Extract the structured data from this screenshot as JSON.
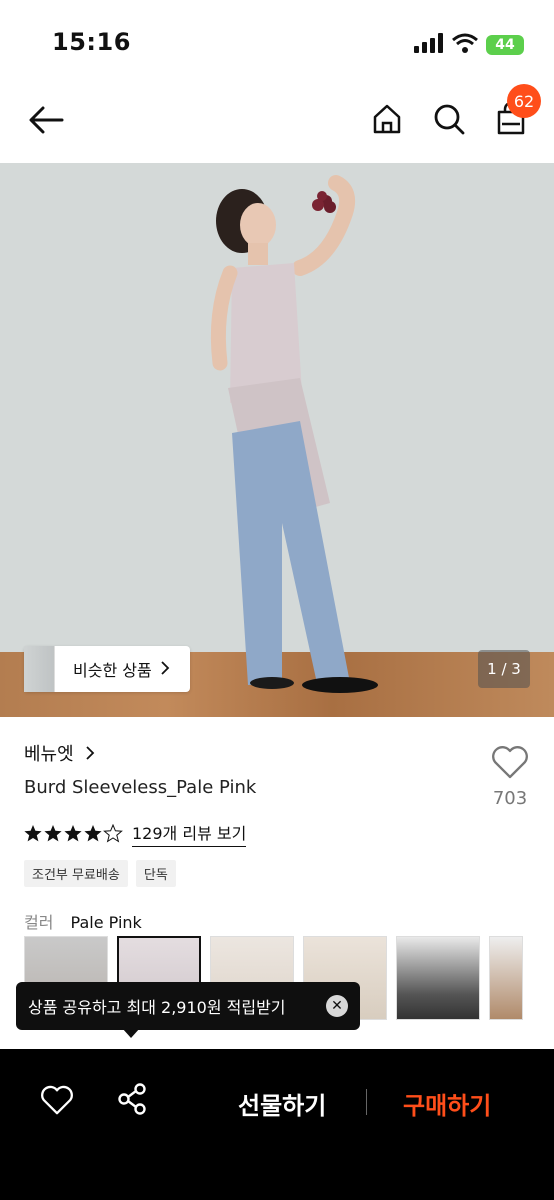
{
  "status_bar": {
    "time": "15:16",
    "battery": "44"
  },
  "nav": {
    "cart_count": "62"
  },
  "hero": {
    "similar_label": "비슷한 상품",
    "page_counter": "1 / 3"
  },
  "product": {
    "brand": "베뉴엣",
    "title": "Burd Sleeveless_Pale Pink",
    "like_count": "703",
    "rating": 4.5,
    "reviews_label": "129개 리뷰 보기",
    "tags": [
      "조건부 무료배송",
      "단독"
    ],
    "color_key": "컬러",
    "color_value": "Pale Pink"
  },
  "tooltip": {
    "text": "상품 공유하고 최대 2,910원 적립받기"
  },
  "bottom_bar": {
    "gift_label": "선물하기",
    "buy_label": "구매하기"
  },
  "colors": {
    "accent": "#ff4e1a",
    "badge": "#ff4e1a",
    "battery": "#5ccf4c"
  }
}
